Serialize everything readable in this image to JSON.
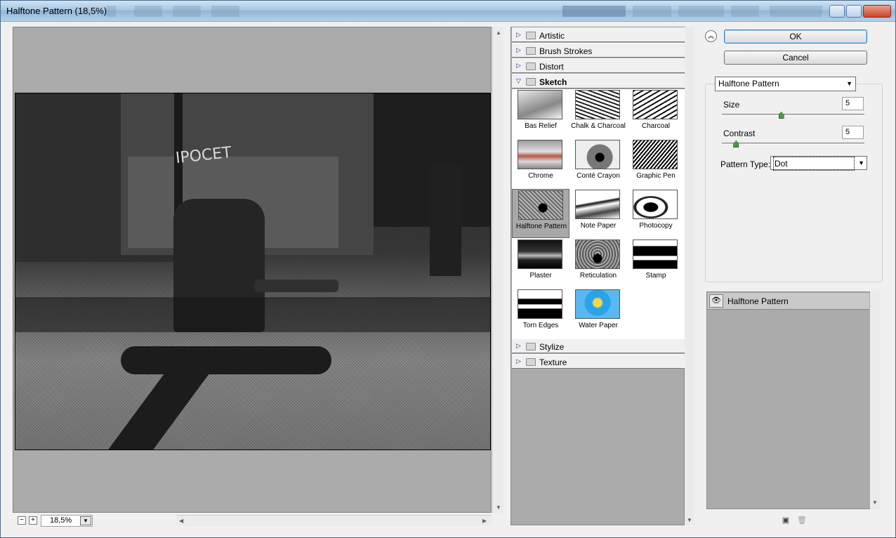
{
  "window": {
    "title": "Halftone Pattern (18,5%)"
  },
  "preview": {
    "sign_text": "ІРОСЕТ",
    "zoom": "18,5%",
    "zoom_minus": "−",
    "zoom_plus": "+"
  },
  "gallery": {
    "categories_top": [
      {
        "label": "Artistic",
        "open": false
      },
      {
        "label": "Brush Strokes",
        "open": false
      },
      {
        "label": "Distort",
        "open": false
      },
      {
        "label": "Sketch",
        "open": true
      }
    ],
    "sketch_filters": [
      {
        "label": "Bas Relief",
        "selected": false
      },
      {
        "label": "Chalk & Charcoal",
        "selected": false
      },
      {
        "label": "Charcoal",
        "selected": false
      },
      {
        "label": "Chrome",
        "selected": false
      },
      {
        "label": "Conté Crayon",
        "selected": false
      },
      {
        "label": "Graphic Pen",
        "selected": false
      },
      {
        "label": "Halftone Pattern",
        "selected": true
      },
      {
        "label": "Note Paper",
        "selected": false
      },
      {
        "label": "Photocopy",
        "selected": false
      },
      {
        "label": "Plaster",
        "selected": false
      },
      {
        "label": "Reticulation",
        "selected": false
      },
      {
        "label": "Stamp",
        "selected": false
      },
      {
        "label": "Torn Edges",
        "selected": false
      },
      {
        "label": "Water Paper",
        "selected": false
      }
    ],
    "categories_bottom": [
      {
        "label": "Stylize"
      },
      {
        "label": "Texture"
      }
    ]
  },
  "controls": {
    "ok_label": "OK",
    "cancel_label": "Cancel",
    "filter_selected": "Halftone Pattern",
    "size_label": "Size",
    "size_value": "5",
    "size_level": 5,
    "size_max": 12,
    "contrast_label": "Contrast",
    "contrast_value": "5",
    "contrast_level": 5,
    "contrast_max": 50,
    "pattern_type_label": "Pattern Type:",
    "pattern_type_value": "Dot"
  },
  "layers": {
    "items": [
      {
        "label": "Halftone Pattern"
      }
    ]
  },
  "icons": {
    "collapse": "double-chevron-up-icon",
    "eye": "eye-icon",
    "new_layer": "new-effect-layer-icon",
    "delete": "trash-icon",
    "folder": "folder-icon",
    "expand": "triangle-right-icon"
  }
}
